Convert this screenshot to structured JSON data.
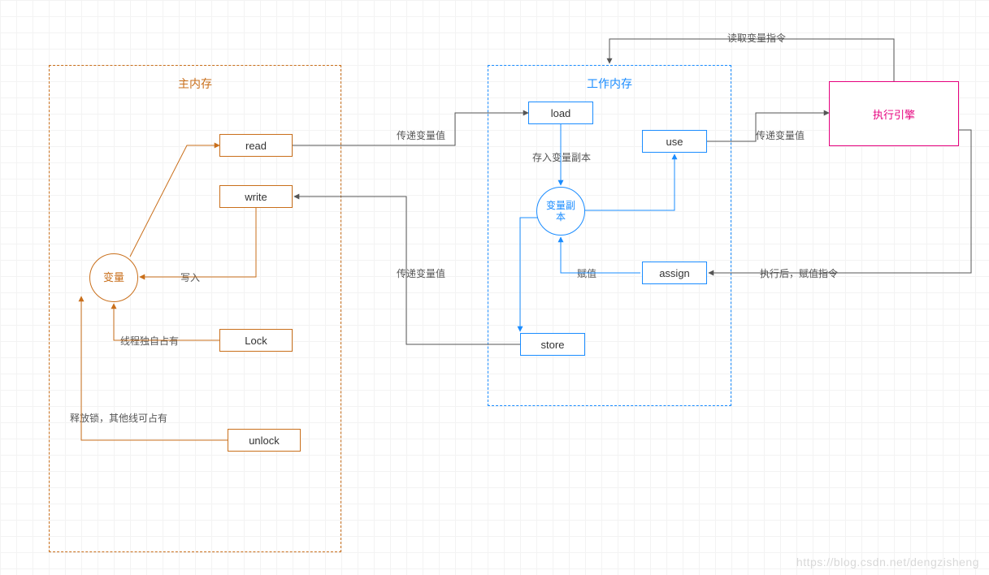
{
  "main_memory": {
    "title": "主内存",
    "variable": "变量",
    "read": "read",
    "write": "write",
    "lock": "Lock",
    "unlock": "unlock",
    "label_write_in": "写入",
    "label_thread_owns": "线程独自占有",
    "label_release": "释放锁，其他线可占有"
  },
  "working_memory": {
    "title": "工作内存",
    "load": "load",
    "use": "use",
    "copy": "变量副\n本",
    "assign": "assign",
    "store": "store",
    "label_store_copy": "存入变量副本",
    "label_assign_val": "赋值"
  },
  "engine": "执行引擎",
  "edge_labels": {
    "pass_value_1": "传递变量值",
    "pass_value_2": "传递变量值",
    "pass_value_3": "传递变量值",
    "read_instr": "读取变量指令",
    "after_exec": "执行后，赋值指令"
  },
  "watermark": "https://blog.csdn.net/dengzisheng"
}
